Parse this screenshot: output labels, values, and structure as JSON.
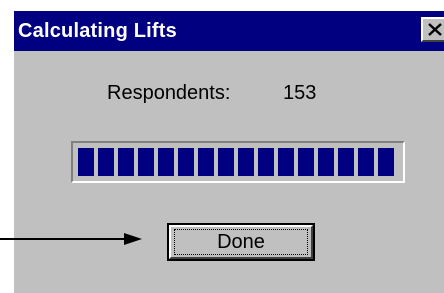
{
  "window": {
    "title": "Calculating Lifts",
    "close_glyph": "X"
  },
  "respondents": {
    "label": "Respondents:",
    "value": "153"
  },
  "progress": {
    "fraction": 1.0,
    "fill_color": "#000080"
  },
  "buttons": {
    "done_label": "Done"
  },
  "annotation": {
    "arrow_target": "done-button"
  },
  "colors": {
    "dialog_background": "#c0c0c0",
    "titlebar": "#000080",
    "title_text": "#ffffff"
  }
}
